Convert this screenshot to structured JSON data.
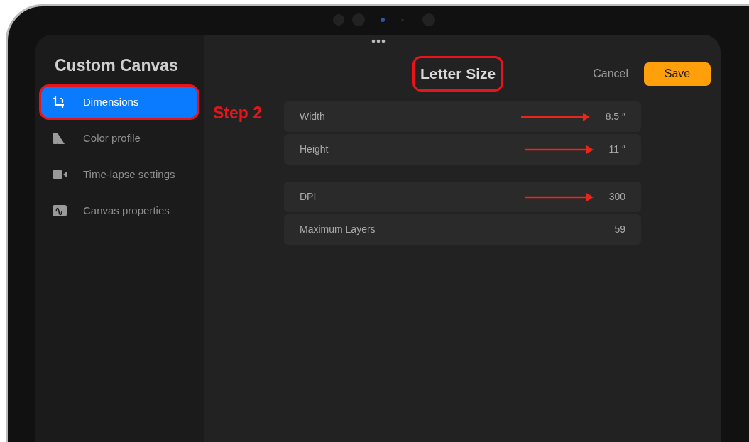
{
  "sidebar": {
    "title": "Custom Canvas",
    "items": [
      {
        "label": "Dimensions",
        "selected": true,
        "highlighted": true
      },
      {
        "label": "Color profile",
        "selected": false,
        "highlighted": false
      },
      {
        "label": "Time-lapse settings",
        "selected": false,
        "highlighted": false
      },
      {
        "label": "Canvas properties",
        "selected": false,
        "highlighted": false
      }
    ]
  },
  "annotation": {
    "label": "Step 2"
  },
  "header": {
    "title": "Letter Size",
    "title_highlighted": true,
    "cancel": "Cancel",
    "save": "Save"
  },
  "groups": [
    [
      {
        "label": "Width",
        "value": "8.5 ″",
        "arrow": true
      },
      {
        "label": "Height",
        "value": "11 ″",
        "arrow": true
      }
    ],
    [
      {
        "label": "DPI",
        "value": "300",
        "arrow": true
      },
      {
        "label": "Maximum Layers",
        "value": "59",
        "arrow": false
      }
    ]
  ]
}
